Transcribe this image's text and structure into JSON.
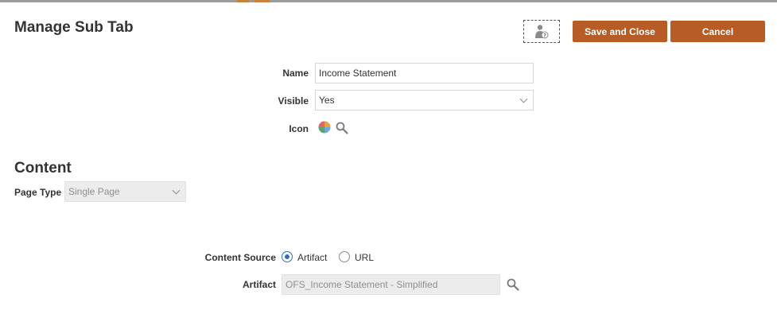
{
  "header": {
    "title": "Manage Sub Tab",
    "save_label": "Save and Close",
    "cancel_label": "Cancel"
  },
  "form": {
    "name_label": "Name",
    "name_value": "Income Statement",
    "visible_label": "Visible",
    "visible_value": "Yes",
    "icon_label": "Icon"
  },
  "content": {
    "section_title": "Content",
    "page_type_label": "Page Type",
    "page_type_value": "Single Page",
    "source_label": "Content Source",
    "source_options": [
      "Artifact",
      "URL"
    ],
    "source_selected": "Artifact",
    "artifact_label": "Artifact",
    "artifact_value": "OFS_Income Statement - Simplified"
  },
  "colors": {
    "accent_button": "#b75c24",
    "radio_selected": "#2f6fb6",
    "top_bar": "#9b9b9b"
  },
  "icons": [
    "pie-chart-icon",
    "search-icon",
    "user-help-icon",
    "chevron-down-icon"
  ]
}
